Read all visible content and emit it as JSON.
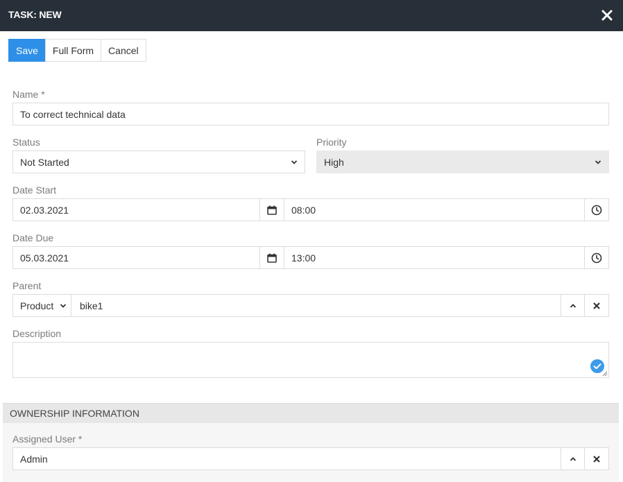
{
  "header": {
    "title": "TASK: NEW"
  },
  "toolbar": {
    "save": "Save",
    "full_form": "Full Form",
    "cancel": "Cancel"
  },
  "form": {
    "name": {
      "label": "Name *",
      "value": "To correct technical data"
    },
    "status": {
      "label": "Status",
      "value": "Not Started"
    },
    "priority": {
      "label": "Priority",
      "value": "High"
    },
    "date_start": {
      "label": "Date Start",
      "date": "02.03.2021",
      "time": "08:00"
    },
    "date_due": {
      "label": "Date Due",
      "date": "05.03.2021",
      "time": "13:00"
    },
    "parent": {
      "label": "Parent",
      "type": "Product",
      "value": "bike1"
    },
    "description": {
      "label": "Description",
      "value": ""
    }
  },
  "ownership": {
    "title": "OWNERSHIP INFORMATION",
    "assigned_user": {
      "label": "Assigned User *",
      "value": "Admin"
    }
  },
  "colors": {
    "header_bg": "#273038",
    "primary": "#2e8fe8",
    "check_badge": "#3d9be9"
  }
}
